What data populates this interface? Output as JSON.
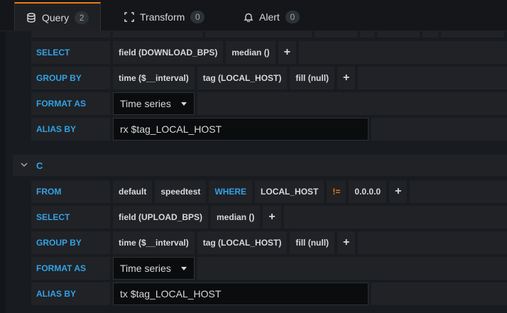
{
  "tabs": [
    {
      "label": "Query",
      "count": "2"
    },
    {
      "label": "Transform",
      "count": "0"
    },
    {
      "label": "Alert",
      "count": "0"
    }
  ],
  "query_b": {
    "select_kw": "SELECT",
    "select_field": "field (DOWNLOAD_BPS)",
    "select_fn": "median ()",
    "groupby_kw": "GROUP BY",
    "groupby_time": "time ($__interval)",
    "groupby_tag": "tag (LOCAL_HOST)",
    "groupby_fill": "fill (null)",
    "format_kw": "FORMAT AS",
    "format_value": "Time series",
    "alias_kw": "ALIAS BY",
    "alias_value": "rx $tag_LOCAL_HOST"
  },
  "query_c": {
    "letter": "C",
    "from_kw": "FROM",
    "from_policy": "default",
    "from_measurement": "speedtest",
    "where_kw": "WHERE",
    "where_key": "LOCAL_HOST",
    "where_op": "!=",
    "where_value": "0.0.0.0",
    "select_kw": "SELECT",
    "select_field": "field (UPLOAD_BPS)",
    "select_fn": "median ()",
    "groupby_kw": "GROUP BY",
    "groupby_time": "time ($__interval)",
    "groupby_tag": "tag (LOCAL_HOST)",
    "groupby_fill": "fill (null)",
    "format_kw": "FORMAT AS",
    "format_value": "Time series",
    "alias_kw": "ALIAS BY",
    "alias_value": "tx $tag_LOCAL_HOST"
  },
  "plus_label": "+",
  "icons": {
    "query": "database-icon",
    "transform": "transform-icon",
    "alert": "bell-icon",
    "collapse": "chevron-down-icon"
  }
}
